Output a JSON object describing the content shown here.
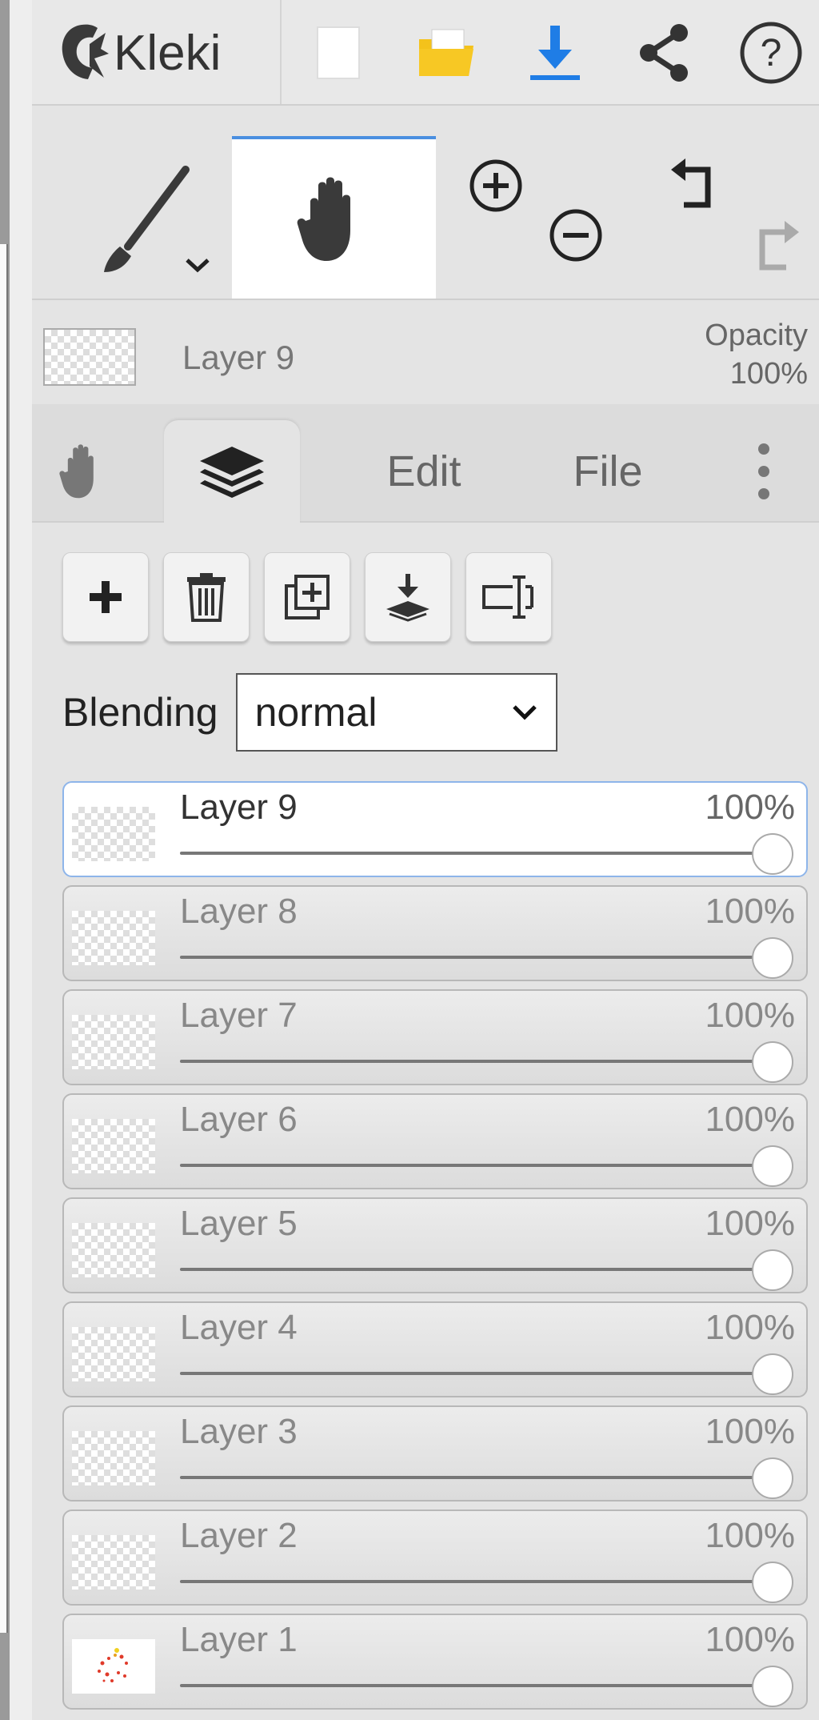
{
  "header": {
    "logo_text": "Kleki",
    "icons": [
      "new-image-icon",
      "open-folder-icon",
      "download-icon",
      "share-icon",
      "help-icon"
    ]
  },
  "toolrow": {
    "tools": [
      "brush-icon",
      "hand-icon",
      "zoom-in-icon",
      "zoom-out-icon",
      "undo-icon",
      "redo-icon"
    ]
  },
  "current_layer": {
    "name": "Layer 9",
    "opacity_label": "Opacity",
    "opacity_value": "100%"
  },
  "tabs": {
    "edit": "Edit",
    "file": "File"
  },
  "blending": {
    "label": "Blending",
    "value": "normal"
  },
  "layers": [
    {
      "name": "Layer 9",
      "opacity": "100%",
      "active": true
    },
    {
      "name": "Layer 8",
      "opacity": "100%",
      "active": false
    },
    {
      "name": "Layer 7",
      "opacity": "100%",
      "active": false
    },
    {
      "name": "Layer 6",
      "opacity": "100%",
      "active": false
    },
    {
      "name": "Layer 5",
      "opacity": "100%",
      "active": false
    },
    {
      "name": "Layer 4",
      "opacity": "100%",
      "active": false
    },
    {
      "name": "Layer 3",
      "opacity": "100%",
      "active": false
    },
    {
      "name": "Layer 2",
      "opacity": "100%",
      "active": false
    },
    {
      "name": "Layer 1",
      "opacity": "100%",
      "active": false
    }
  ],
  "colors": {
    "accent": "#4a8fe0",
    "download": "#1f7de6",
    "folder": "#f4c21b"
  }
}
